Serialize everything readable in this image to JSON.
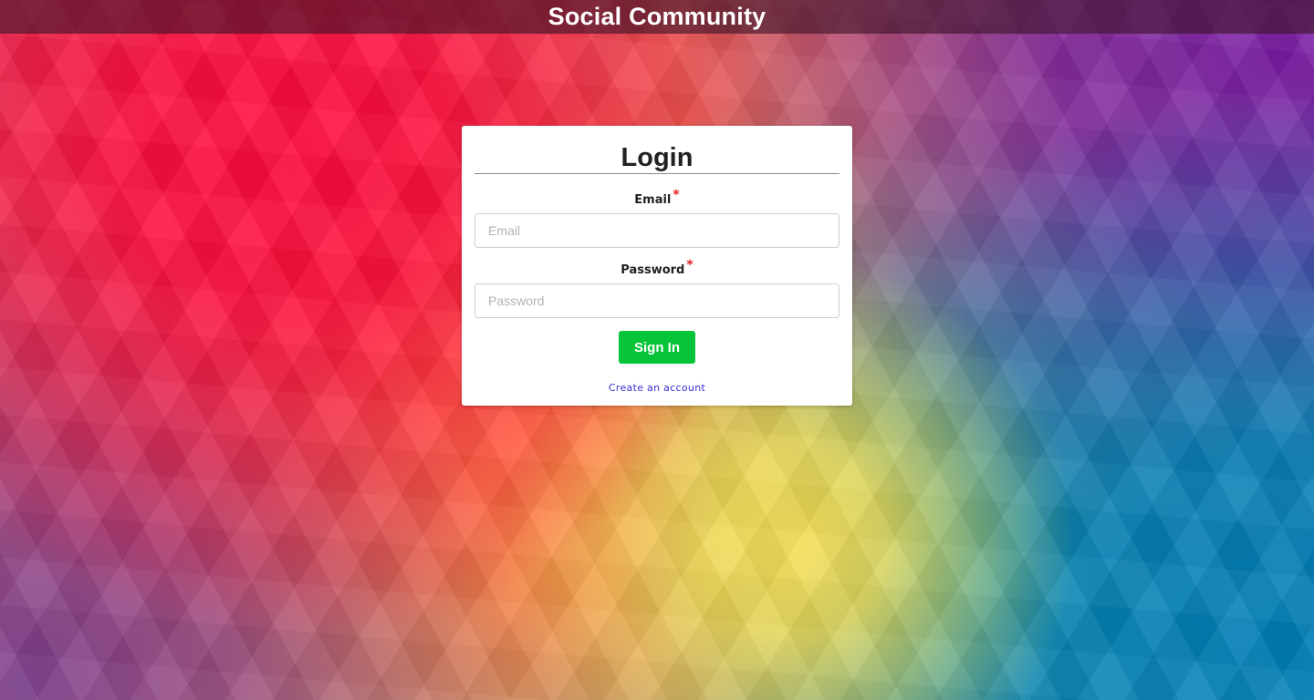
{
  "header": {
    "title": "Social Community"
  },
  "login": {
    "title": "Login",
    "email": {
      "label": "Email",
      "required_marker": "*",
      "placeholder": "Email",
      "value": ""
    },
    "password": {
      "label": "Password",
      "required_marker": "*",
      "placeholder": "Password",
      "value": ""
    },
    "submit_label": "Sign In",
    "create_account_link": "Create an account"
  },
  "colors": {
    "header_bg": "#3c1428",
    "button_green": "#06c43a",
    "link_blue": "#3a2fd6",
    "required_red": "#e0201f"
  }
}
